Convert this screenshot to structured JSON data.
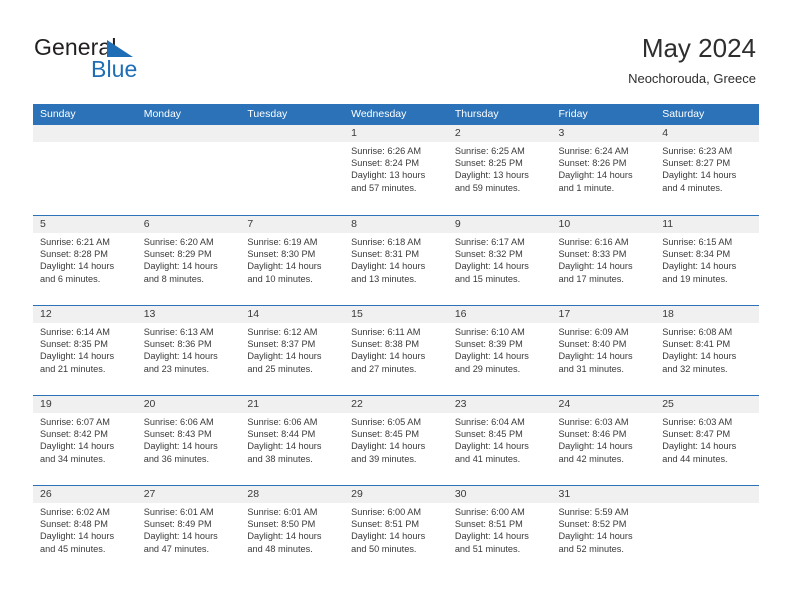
{
  "brand": {
    "line1": "General",
    "line2": "Blue",
    "mark_icon": "triangle-logo-icon",
    "color_dark": "#231f20",
    "color_blue": "#1f6eb5"
  },
  "header": {
    "title": "May 2024",
    "subtitle": "Neochorouda, Greece"
  },
  "theme": {
    "header_blue": "#2b72b8",
    "day_band_gray": "#f0f0f0",
    "text": "#3a3a3a"
  },
  "weekdays": [
    "Sunday",
    "Monday",
    "Tuesday",
    "Wednesday",
    "Thursday",
    "Friday",
    "Saturday"
  ],
  "weeks": [
    [
      {
        "date": "",
        "sunrise": "",
        "sunset": "",
        "daylight": "",
        "empty": true
      },
      {
        "date": "",
        "sunrise": "",
        "sunset": "",
        "daylight": "",
        "empty": true
      },
      {
        "date": "",
        "sunrise": "",
        "sunset": "",
        "daylight": "",
        "empty": true
      },
      {
        "date": "1",
        "sunrise": "Sunrise: 6:26 AM",
        "sunset": "Sunset: 8:24 PM",
        "daylight": "Daylight: 13 hours and 57 minutes."
      },
      {
        "date": "2",
        "sunrise": "Sunrise: 6:25 AM",
        "sunset": "Sunset: 8:25 PM",
        "daylight": "Daylight: 13 hours and 59 minutes."
      },
      {
        "date": "3",
        "sunrise": "Sunrise: 6:24 AM",
        "sunset": "Sunset: 8:26 PM",
        "daylight": "Daylight: 14 hours and 1 minute."
      },
      {
        "date": "4",
        "sunrise": "Sunrise: 6:23 AM",
        "sunset": "Sunset: 8:27 PM",
        "daylight": "Daylight: 14 hours and 4 minutes."
      }
    ],
    [
      {
        "date": "5",
        "sunrise": "Sunrise: 6:21 AM",
        "sunset": "Sunset: 8:28 PM",
        "daylight": "Daylight: 14 hours and 6 minutes."
      },
      {
        "date": "6",
        "sunrise": "Sunrise: 6:20 AM",
        "sunset": "Sunset: 8:29 PM",
        "daylight": "Daylight: 14 hours and 8 minutes."
      },
      {
        "date": "7",
        "sunrise": "Sunrise: 6:19 AM",
        "sunset": "Sunset: 8:30 PM",
        "daylight": "Daylight: 14 hours and 10 minutes."
      },
      {
        "date": "8",
        "sunrise": "Sunrise: 6:18 AM",
        "sunset": "Sunset: 8:31 PM",
        "daylight": "Daylight: 14 hours and 13 minutes."
      },
      {
        "date": "9",
        "sunrise": "Sunrise: 6:17 AM",
        "sunset": "Sunset: 8:32 PM",
        "daylight": "Daylight: 14 hours and 15 minutes."
      },
      {
        "date": "10",
        "sunrise": "Sunrise: 6:16 AM",
        "sunset": "Sunset: 8:33 PM",
        "daylight": "Daylight: 14 hours and 17 minutes."
      },
      {
        "date": "11",
        "sunrise": "Sunrise: 6:15 AM",
        "sunset": "Sunset: 8:34 PM",
        "daylight": "Daylight: 14 hours and 19 minutes."
      }
    ],
    [
      {
        "date": "12",
        "sunrise": "Sunrise: 6:14 AM",
        "sunset": "Sunset: 8:35 PM",
        "daylight": "Daylight: 14 hours and 21 minutes."
      },
      {
        "date": "13",
        "sunrise": "Sunrise: 6:13 AM",
        "sunset": "Sunset: 8:36 PM",
        "daylight": "Daylight: 14 hours and 23 minutes."
      },
      {
        "date": "14",
        "sunrise": "Sunrise: 6:12 AM",
        "sunset": "Sunset: 8:37 PM",
        "daylight": "Daylight: 14 hours and 25 minutes."
      },
      {
        "date": "15",
        "sunrise": "Sunrise: 6:11 AM",
        "sunset": "Sunset: 8:38 PM",
        "daylight": "Daylight: 14 hours and 27 minutes."
      },
      {
        "date": "16",
        "sunrise": "Sunrise: 6:10 AM",
        "sunset": "Sunset: 8:39 PM",
        "daylight": "Daylight: 14 hours and 29 minutes."
      },
      {
        "date": "17",
        "sunrise": "Sunrise: 6:09 AM",
        "sunset": "Sunset: 8:40 PM",
        "daylight": "Daylight: 14 hours and 31 minutes."
      },
      {
        "date": "18",
        "sunrise": "Sunrise: 6:08 AM",
        "sunset": "Sunset: 8:41 PM",
        "daylight": "Daylight: 14 hours and 32 minutes."
      }
    ],
    [
      {
        "date": "19",
        "sunrise": "Sunrise: 6:07 AM",
        "sunset": "Sunset: 8:42 PM",
        "daylight": "Daylight: 14 hours and 34 minutes."
      },
      {
        "date": "20",
        "sunrise": "Sunrise: 6:06 AM",
        "sunset": "Sunset: 8:43 PM",
        "daylight": "Daylight: 14 hours and 36 minutes."
      },
      {
        "date": "21",
        "sunrise": "Sunrise: 6:06 AM",
        "sunset": "Sunset: 8:44 PM",
        "daylight": "Daylight: 14 hours and 38 minutes."
      },
      {
        "date": "22",
        "sunrise": "Sunrise: 6:05 AM",
        "sunset": "Sunset: 8:45 PM",
        "daylight": "Daylight: 14 hours and 39 minutes."
      },
      {
        "date": "23",
        "sunrise": "Sunrise: 6:04 AM",
        "sunset": "Sunset: 8:45 PM",
        "daylight": "Daylight: 14 hours and 41 minutes."
      },
      {
        "date": "24",
        "sunrise": "Sunrise: 6:03 AM",
        "sunset": "Sunset: 8:46 PM",
        "daylight": "Daylight: 14 hours and 42 minutes."
      },
      {
        "date": "25",
        "sunrise": "Sunrise: 6:03 AM",
        "sunset": "Sunset: 8:47 PM",
        "daylight": "Daylight: 14 hours and 44 minutes."
      }
    ],
    [
      {
        "date": "26",
        "sunrise": "Sunrise: 6:02 AM",
        "sunset": "Sunset: 8:48 PM",
        "daylight": "Daylight: 14 hours and 45 minutes."
      },
      {
        "date": "27",
        "sunrise": "Sunrise: 6:01 AM",
        "sunset": "Sunset: 8:49 PM",
        "daylight": "Daylight: 14 hours and 47 minutes."
      },
      {
        "date": "28",
        "sunrise": "Sunrise: 6:01 AM",
        "sunset": "Sunset: 8:50 PM",
        "daylight": "Daylight: 14 hours and 48 minutes."
      },
      {
        "date": "29",
        "sunrise": "Sunrise: 6:00 AM",
        "sunset": "Sunset: 8:51 PM",
        "daylight": "Daylight: 14 hours and 50 minutes."
      },
      {
        "date": "30",
        "sunrise": "Sunrise: 6:00 AM",
        "sunset": "Sunset: 8:51 PM",
        "daylight": "Daylight: 14 hours and 51 minutes."
      },
      {
        "date": "31",
        "sunrise": "Sunrise: 5:59 AM",
        "sunset": "Sunset: 8:52 PM",
        "daylight": "Daylight: 14 hours and 52 minutes."
      },
      {
        "date": "",
        "sunrise": "",
        "sunset": "",
        "daylight": "",
        "empty": true
      }
    ]
  ]
}
